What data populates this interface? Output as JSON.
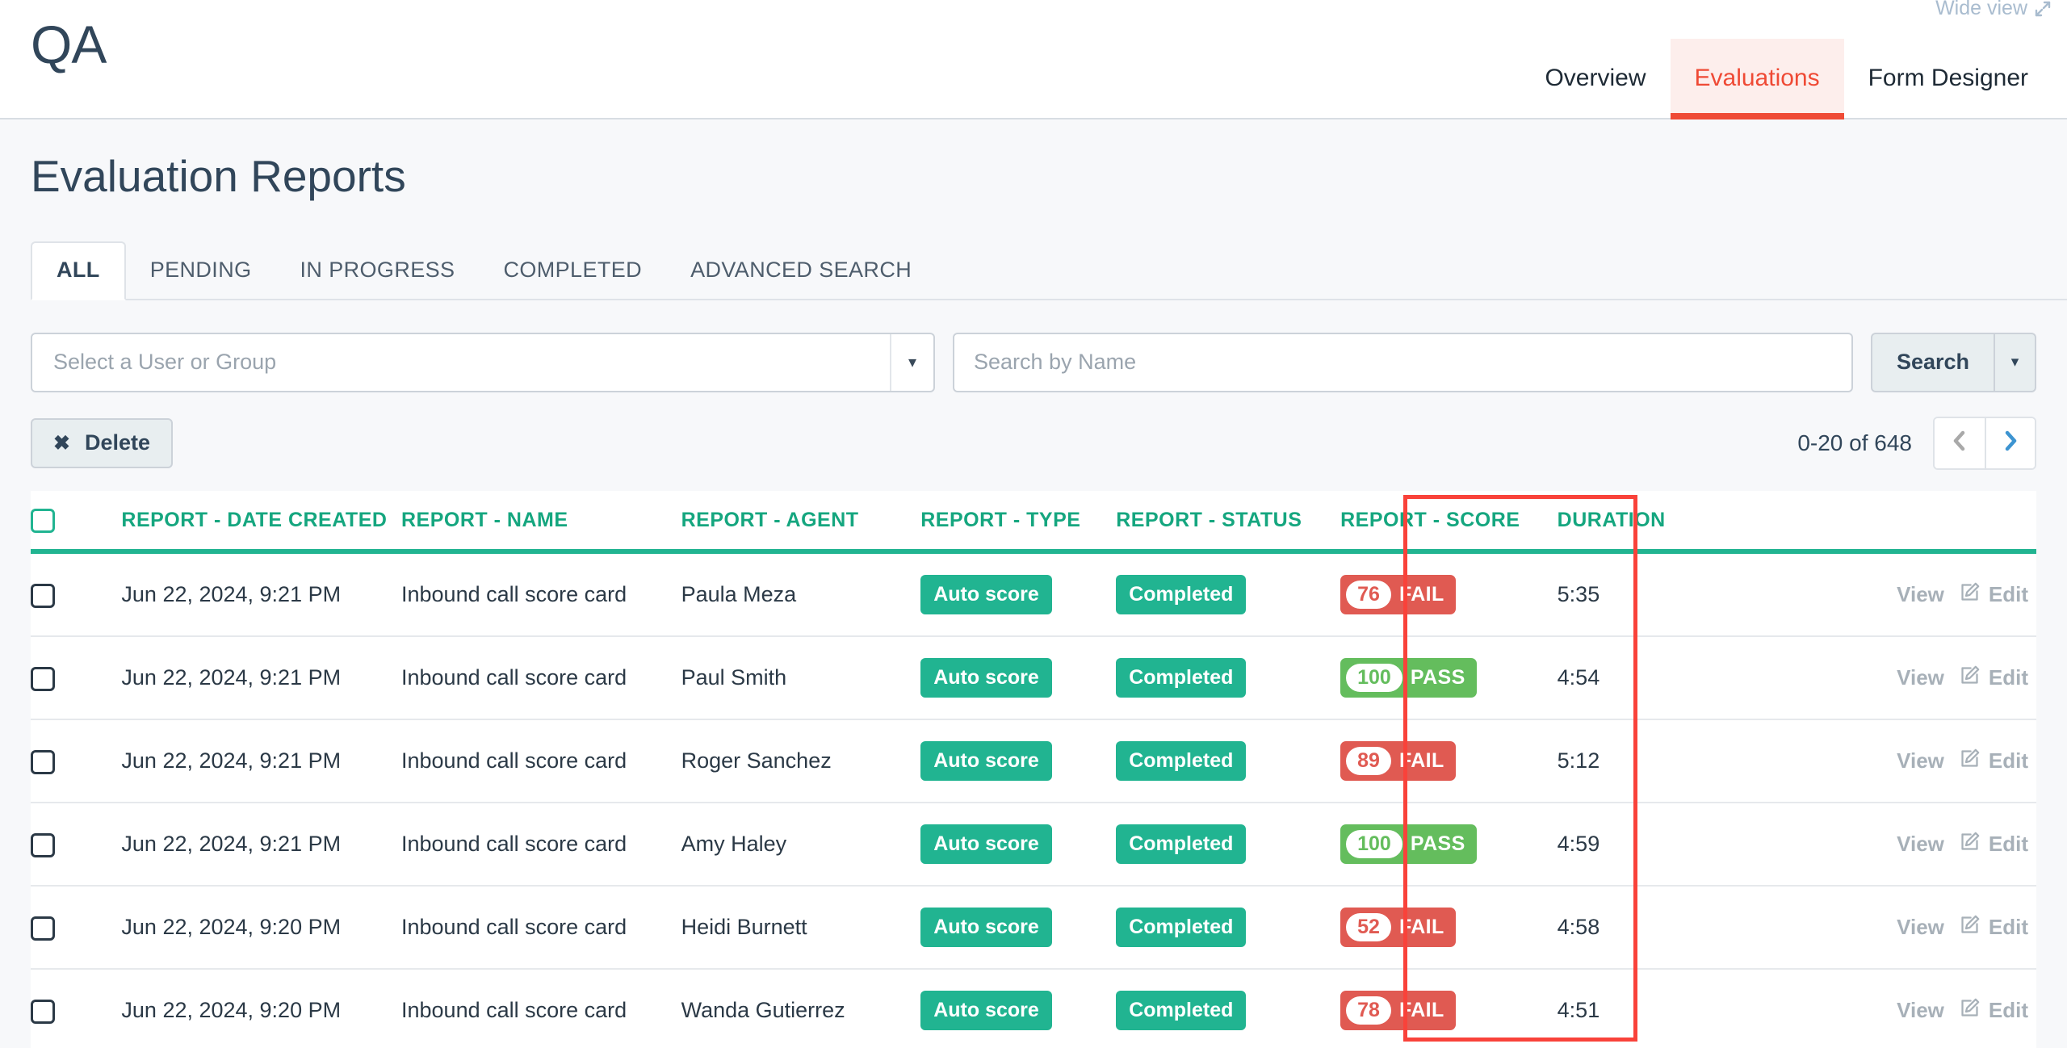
{
  "header": {
    "brand": "QA",
    "wide_view_label": "Wide view",
    "wide_view_icon": "expand-diagonal-icon",
    "nav": [
      {
        "label": "Overview",
        "active": false
      },
      {
        "label": "Evaluations",
        "active": true
      },
      {
        "label": "Form Designer",
        "active": false
      }
    ],
    "active_accent": "#ef4a35"
  },
  "page": {
    "title": "Evaluation Reports",
    "subtabs": [
      {
        "label": "ALL",
        "active": true
      },
      {
        "label": "PENDING",
        "active": false
      },
      {
        "label": "IN PROGRESS",
        "active": false
      },
      {
        "label": "COMPLETED",
        "active": false
      },
      {
        "label": "ADVANCED SEARCH",
        "active": false
      }
    ]
  },
  "filters": {
    "user_group_placeholder": "Select a User or Group",
    "user_group_value": "",
    "search_placeholder": "Search by Name",
    "search_value": "",
    "search_button_label": "Search",
    "search_caret_icon": "chevron-down-icon"
  },
  "actions": {
    "delete_label": "Delete",
    "delete_icon": "close-x-icon"
  },
  "pagination": {
    "range_label": "0-20 of 648",
    "prev_icon": "chevron-left-icon",
    "next_icon": "chevron-right-icon",
    "prev_color": "#a9a9a9",
    "next_color": "#3d94d1"
  },
  "table": {
    "header_accent": "#15a67f",
    "columns": [
      "",
      "REPORT - DATE CREATED",
      "REPORT - NAME",
      "REPORT - AGENT",
      "REPORT - TYPE",
      "REPORT - STATUS",
      "REPORT - SCORE",
      "DURATION",
      ""
    ],
    "row_action_view": "View",
    "row_action_edit": "Edit",
    "row_edit_icon": "pencil-edit-icon",
    "rows": [
      {
        "date": "Jun 22, 2024, 9:21 PM",
        "name": "Inbound call score card",
        "agent": "Paula Meza",
        "type": "Auto score",
        "status": "Completed",
        "score": "76",
        "result": "FAIL",
        "duration": "5:35"
      },
      {
        "date": "Jun 22, 2024, 9:21 PM",
        "name": "Inbound call score card",
        "agent": "Paul Smith",
        "type": "Auto score",
        "status": "Completed",
        "score": "100",
        "result": "PASS",
        "duration": "4:54"
      },
      {
        "date": "Jun 22, 2024, 9:21 PM",
        "name": "Inbound call score card",
        "agent": "Roger Sanchez",
        "type": "Auto score",
        "status": "Completed",
        "score": "89",
        "result": "FAIL",
        "duration": "5:12"
      },
      {
        "date": "Jun 22, 2024, 9:21 PM",
        "name": "Inbound call score card",
        "agent": "Amy Haley",
        "type": "Auto score",
        "status": "Completed",
        "score": "100",
        "result": "PASS",
        "duration": "4:59"
      },
      {
        "date": "Jun 22, 2024, 9:20 PM",
        "name": "Inbound call score card",
        "agent": "Heidi Burnett",
        "type": "Auto score",
        "status": "Completed",
        "score": "52",
        "result": "FAIL",
        "duration": "4:58"
      },
      {
        "date": "Jun 22, 2024, 9:20 PM",
        "name": "Inbound call score card",
        "agent": "Wanda Gutierrez",
        "type": "Auto score",
        "status": "Completed",
        "score": "78",
        "result": "FAIL",
        "duration": "4:51"
      }
    ]
  },
  "annotation": {
    "color": "#f9423a",
    "target_column": "REPORT - SCORE"
  }
}
